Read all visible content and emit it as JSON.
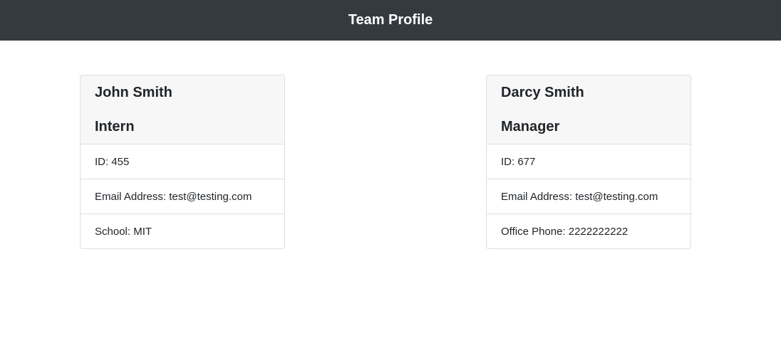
{
  "header": {
    "title": "Team Profile"
  },
  "members": [
    {
      "name": "John Smith",
      "role": "Intern",
      "id_label": "ID: ",
      "id": "455",
      "email_label": "Email Address: ",
      "email": "test@testing.com",
      "extra_label": "School: ",
      "extra": "MIT"
    },
    {
      "name": "Darcy Smith",
      "role": "Manager",
      "id_label": "ID: ",
      "id": "677",
      "email_label": "Email Address: ",
      "email": "test@testing.com",
      "extra_label": "Office Phone: ",
      "extra": "2222222222"
    }
  ],
  "colors": {
    "navbar_bg": "#343a40",
    "card_header_bg": "#f7f7f7",
    "border": "#dfdfdf"
  }
}
